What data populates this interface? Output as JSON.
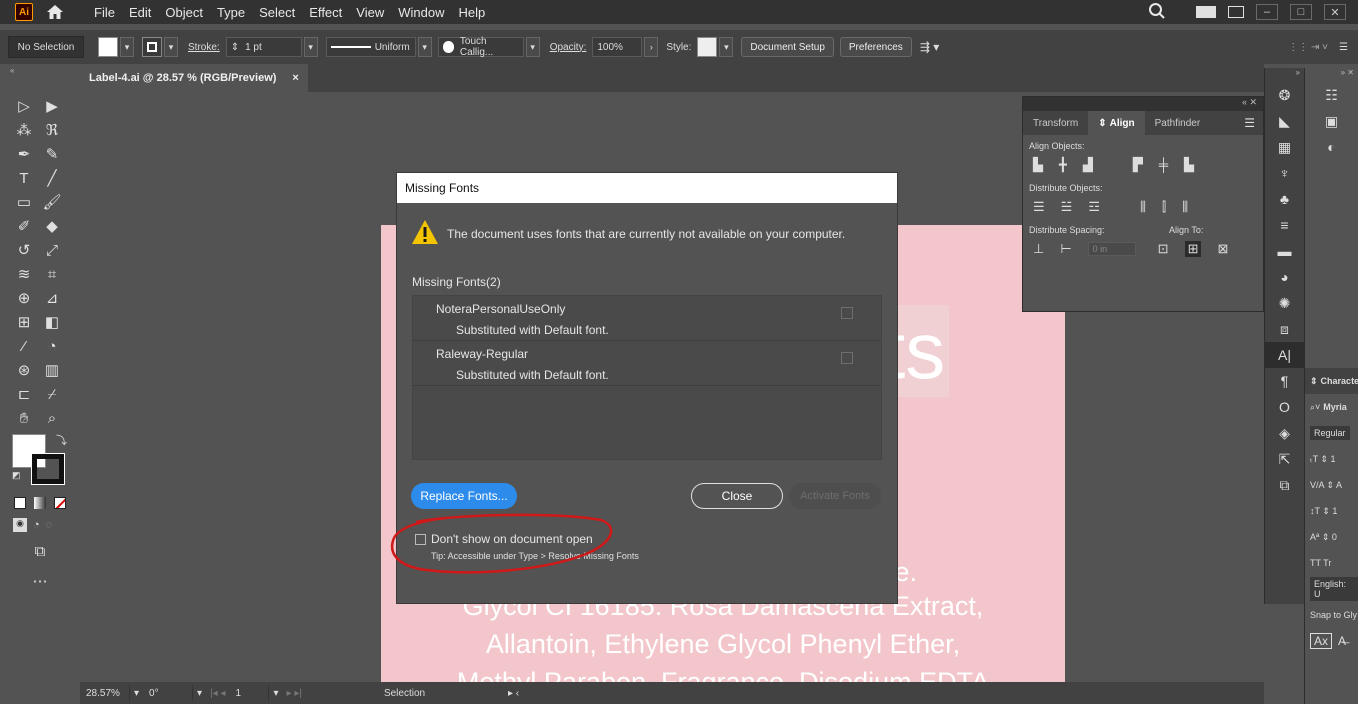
{
  "app": {
    "logo_text": "Ai"
  },
  "menubar": {
    "items": [
      "File",
      "Edit",
      "Object",
      "Type",
      "Select",
      "Effect",
      "View",
      "Window",
      "Help"
    ]
  },
  "controlbar": {
    "selection": "No Selection",
    "stroke_label": "Stroke:",
    "stroke_value": "1 pt",
    "profile": "Uniform",
    "brush": "Touch Callig...",
    "opacity_label": "Opacity:",
    "opacity_value": "100%",
    "style_label": "Style:",
    "document_setup": "Document Setup",
    "preferences": "Preferences"
  },
  "document": {
    "tab_title": "Label-4.ai @ 28.57 % (RGB/Preview)",
    "tab_close": "×"
  },
  "artboard": {
    "big_text": "ts",
    "line1": "e.",
    "line2": "Glycol CI 16185. Rosa Damascena Extract,",
    "line3": "Allantoin, Ethylene Glycol Phenyl Ether,",
    "line4": "Methyl Paraben, Fragrance, Disodium EDTA"
  },
  "statusbar": {
    "zoom": "28.57%",
    "rotation": "0°",
    "artboard_num": "1",
    "tool": "Selection"
  },
  "align_panel": {
    "tabs": [
      "Transform",
      "Align",
      "Pathfinder"
    ],
    "align_objects": "Align Objects:",
    "distribute_objects": "Distribute Objects:",
    "distribute_spacing": "Distribute Spacing:",
    "align_to": "Align To:",
    "spacing_value": "0 in"
  },
  "character_panel": {
    "title": "Characte",
    "font": "Myria",
    "style": "Regular",
    "language": "English: U",
    "snap": "Snap to Gly"
  },
  "dialog": {
    "title": "Missing Fonts",
    "warning": "The document uses fonts that are currently not available on your computer.",
    "missing_label": "Missing Fonts(2)",
    "fonts": [
      {
        "name": "NoteraPersonalUseOnly",
        "sub": "Substituted with Default font."
      },
      {
        "name": "Raleway-Regular",
        "sub": "Substituted with Default font."
      }
    ],
    "replace_button": "Replace Fonts...",
    "close_button": "Close",
    "activate_button": "Activate Fonts",
    "dont_show": "Don't show on document open",
    "tip": "Tip: Accessible under Type > Resolve Missing Fonts"
  },
  "colors": {
    "accent_blue": "#2d8ceb",
    "annotation_red": "#d01818",
    "artboard_pink": "#f2c6ca"
  }
}
